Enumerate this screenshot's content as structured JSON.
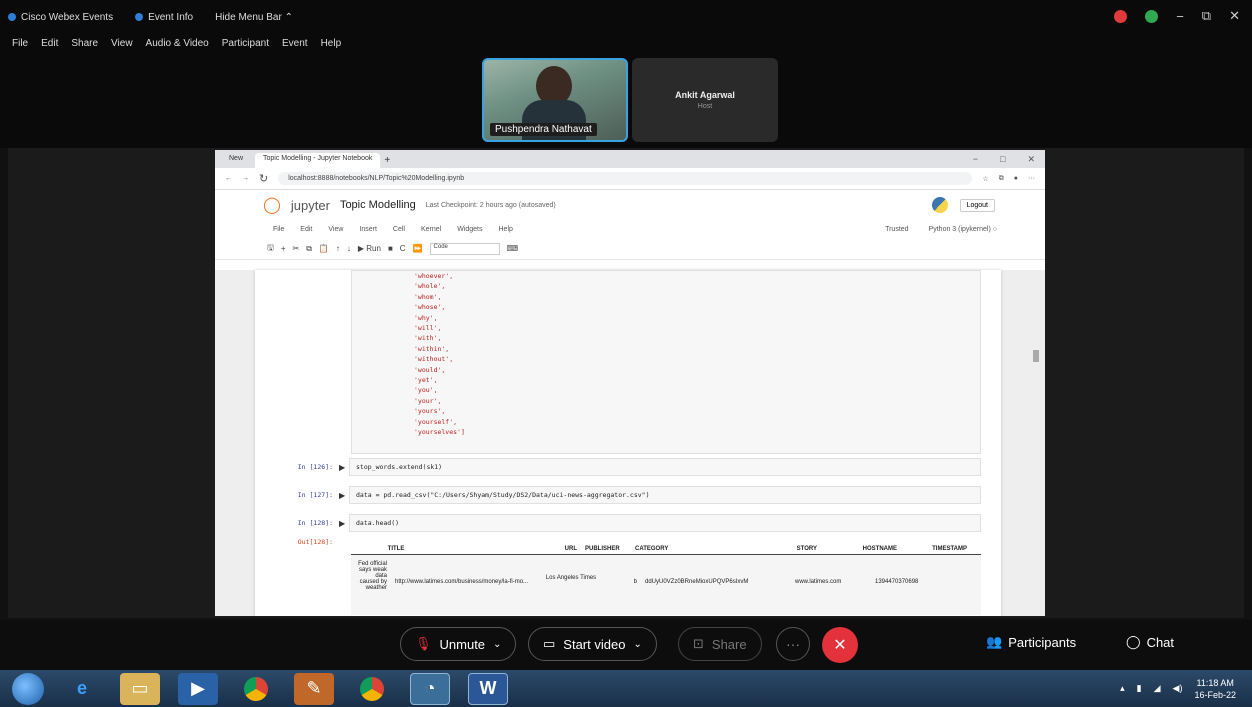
{
  "webex": {
    "titlebar": {
      "app_name": "Cisco Webex Events",
      "event_info": "Event Info",
      "hide_menu": "Hide Menu Bar"
    },
    "menu": [
      "File",
      "Edit",
      "Share",
      "View",
      "Audio & Video",
      "Participant",
      "Event",
      "Help"
    ],
    "window_controls": {
      "minimize": "−",
      "restore": "⧉",
      "close": "✕"
    },
    "participants": [
      {
        "name": "Pushpendra Nathavat"
      },
      {
        "name": "Ankit Agarwal",
        "role": "Host"
      }
    ],
    "controls": {
      "unmute": "Unmute",
      "start_video": "Start video",
      "share": "Share",
      "more": "···",
      "end": "✕",
      "participants": "Participants",
      "chat": "Chat"
    }
  },
  "browser": {
    "tabs": [
      "New",
      "Topic Modelling - Jupyter Notebook"
    ],
    "url": "localhost:8888/notebooks/NLP/Topic%20Modelling.ipynb",
    "winctl": [
      "−",
      "□",
      "✕"
    ]
  },
  "jupyter": {
    "logo": "◯",
    "brand": "jupyter",
    "title": "Topic Modelling",
    "checkpoint": "Last Checkpoint: 2 hours ago (autosaved)",
    "logout": "Logout",
    "menu": [
      "File",
      "Edit",
      "View",
      "Insert",
      "Cell",
      "Kernel",
      "Widgets",
      "Help"
    ],
    "trusted": "Trusted",
    "kernel": "Python 3 (ipykernel) ○",
    "toolbar": [
      "🖫",
      "+",
      "✂",
      "⧉",
      "📋",
      "↑",
      "↓",
      "▶ Run",
      "■",
      "C",
      "⏩"
    ],
    "cell_type": "Code",
    "stopwords_lines": [
      "'whoever',",
      "'whole',",
      "'whom',",
      "'whose',",
      "'why',",
      "'will',",
      "'with',",
      "'within',",
      "'without',",
      "'would',",
      "'yet',",
      "'you',",
      "'your',",
      "'yours',",
      "'yourself',",
      "'yourselves']"
    ],
    "cells": [
      {
        "prompt": "In [126]:",
        "code": "stop_words.extend(sk1)"
      },
      {
        "prompt": "In [127]:",
        "code": "data = pd.read_csv(\"C:/Users/Shyam/Study/DS2/Data/uci-news-aggregator.csv\")"
      },
      {
        "prompt": "In [128]:",
        "code": "data.head()"
      }
    ],
    "out_prompt": "Out[128]:",
    "df": {
      "columns": [
        "TITLE",
        "URL",
        "PUBLISHER",
        "CATEGORY",
        "STORY",
        "HOSTNAME",
        "TIMESTAMP"
      ],
      "row": [
        "Fed official says weak data caused by weather",
        "http://www.latimes.com/business/money/la-fi-mo...",
        "Los Angeles Times",
        "b",
        "ddUyU0VZz0BRneMioxUPQVP6sIxvM",
        "www.latimes.com",
        "1394470370698"
      ]
    }
  },
  "taskbar": {
    "apps": [
      "ie",
      "explorer",
      "media",
      "chrome",
      "paint",
      "chrome2",
      "webex",
      "word"
    ],
    "time": "11:18 AM",
    "date": "16-Feb-22"
  }
}
